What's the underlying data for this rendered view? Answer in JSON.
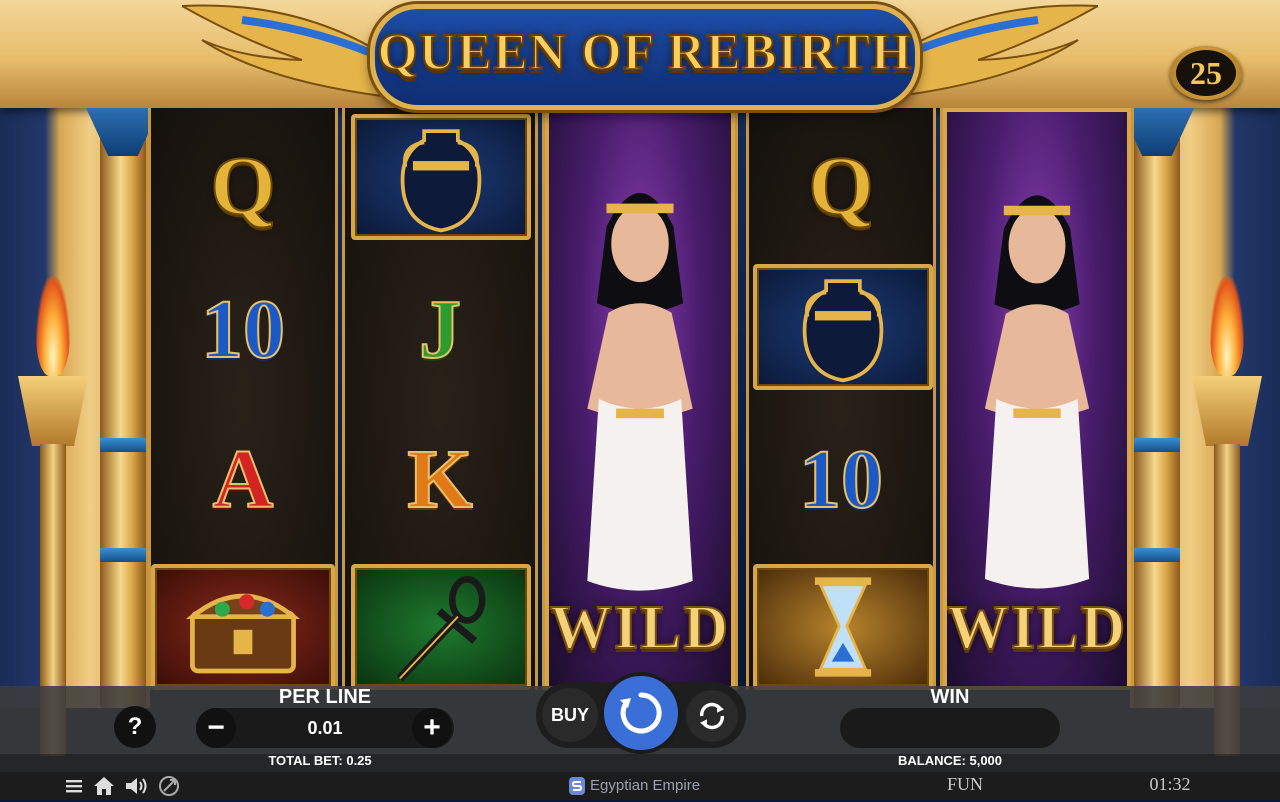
{
  "game": {
    "title": "QUEEN OF REBIRTH",
    "lines": "25",
    "provider": "Egyptian Empire",
    "mode": "FUN",
    "clock": "01:32"
  },
  "reels": [
    {
      "symbols": [
        "Q",
        "10",
        "A",
        "treasure-chest"
      ]
    },
    {
      "symbols": [
        "vase",
        "J",
        "K",
        "ankh"
      ]
    },
    {
      "symbols": [
        "queen-wild"
      ],
      "wild_label": "WILD"
    },
    {
      "symbols": [
        "Q",
        "vase",
        "10",
        "hourglass"
      ]
    },
    {
      "symbols": [
        "queen-wild"
      ],
      "wild_label": "WILD"
    }
  ],
  "controls": {
    "per_line_label": "PER LINE",
    "per_line_value": "0.01",
    "minus": "−",
    "plus": "+",
    "help": "?",
    "buy": "BUY",
    "win_label": "WIN",
    "win_value": "",
    "total_bet": "TOTAL BET: 0.25",
    "balance": "BALANCE: 5,000"
  },
  "icons": [
    "menu-icon",
    "home-icon",
    "sound-icon",
    "turbo-icon",
    "spin-icon",
    "autoplay-icon",
    "provider-logo-icon"
  ],
  "colors": {
    "gold": "#e0b24f",
    "title_blue": "#1e4ea8",
    "spin_blue": "#3a6fd8"
  }
}
